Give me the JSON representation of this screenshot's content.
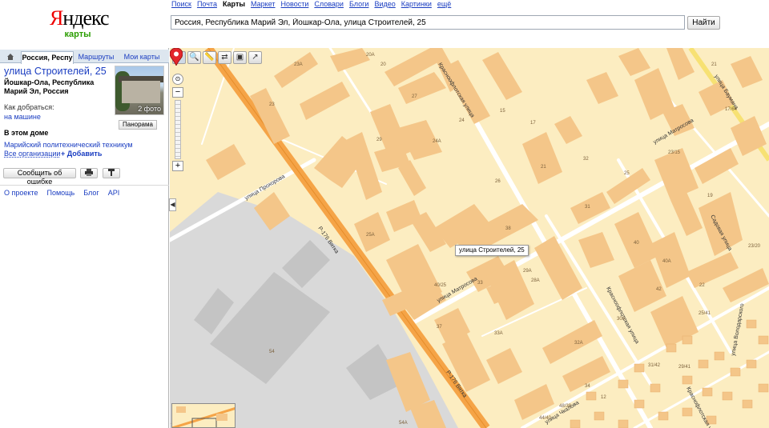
{
  "logo": {
    "brand_first": "Я",
    "brand_rest": "ндекс",
    "sub": "карты"
  },
  "services": [
    {
      "label": "Поиск",
      "active": false
    },
    {
      "label": "Почта",
      "active": false
    },
    {
      "label": "Карты",
      "active": true
    },
    {
      "label": "Маркет",
      "active": false
    },
    {
      "label": "Новости",
      "active": false
    },
    {
      "label": "Словари",
      "active": false
    },
    {
      "label": "Блоги",
      "active": false
    },
    {
      "label": "Видео",
      "active": false
    },
    {
      "label": "Картинки",
      "active": false
    },
    {
      "label": "ещё",
      "active": false
    }
  ],
  "search": {
    "value": "Россия, Республика Марий Эл, Йошкар-Ола, улица Строителей, 25",
    "button": "Найти"
  },
  "tabs": {
    "home_icon": "home-icon",
    "place": "Россия, Респу",
    "routes": "Маршруты",
    "mymaps": "Мои карты"
  },
  "place": {
    "title": "улица Строителей, 25",
    "address": "Йошкар-Ола, Республика Марий Эл, Россия",
    "how_to_get": "Как добраться:",
    "by_car": "на машине",
    "photo_count": "2 фото",
    "panorama": "Панорама",
    "in_house": "В этом доме",
    "org": "Марийский политехнический техникум",
    "all_orgs": "Все организации",
    "add": "+ Добавить",
    "report": "Сообщить об ошибке"
  },
  "footer": [
    "О проекте",
    "Помощь",
    "Блог",
    "API"
  ],
  "map": {
    "marker_label": "улица Строителей, 25",
    "streets": {
      "vyatka1": "Р-176 Вятка",
      "vyatka2": "Р-176 Вятка",
      "prokhorova": "улица Прохорова",
      "krasnoflot1": "Красноофлотская улица",
      "krasnoflot2": "Красноофлотская улица",
      "krasnoflot3": "Краснофлотская улица",
      "matrosova1": "улица Матросова",
      "matrosova2": "улица Матросова",
      "baumana": "улица Баумана",
      "sadovaya": "Садовая улица",
      "volodarskogo": "улица Володарского",
      "chkalova": "улица Чкалова"
    },
    "house_numbers": [
      "23А",
      "20А",
      "20",
      "23",
      "27",
      "15",
      "24",
      "24А",
      "17",
      "21",
      "26",
      "25",
      "29",
      "32",
      "31",
      "25А",
      "38",
      "30",
      "29А",
      "28А",
      "40",
      "33",
      "40/25",
      "37",
      "33А",
      "32А",
      "34",
      "30А",
      "42",
      "40А",
      "22",
      "54",
      "54А",
      "21",
      "23/15",
      "19",
      "17/64",
      "23/20",
      "12",
      "25/41",
      "29/41",
      "31/42",
      "44/40",
      "48/38"
    ],
    "colors": {
      "background": "#fcedc1",
      "building": "#f4c689",
      "highway": "#f5a447",
      "industrial": "#d9d9d9",
      "road": "#ffffff"
    }
  }
}
